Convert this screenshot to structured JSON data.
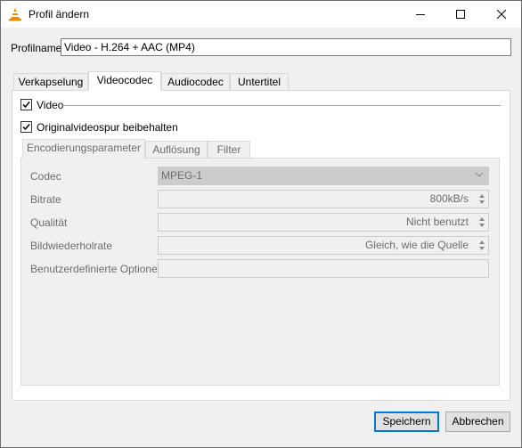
{
  "window": {
    "title": "Profil ändern",
    "icon": "vlc-cone-icon",
    "controls": [
      "minimize-icon",
      "maximize-icon",
      "close-icon"
    ]
  },
  "profile": {
    "label": "Profilname",
    "value": "Video - H.264 + AAC (MP4)"
  },
  "tabs": [
    {
      "label": "Verkapselung",
      "active": false
    },
    {
      "label": "Videocodec",
      "active": true
    },
    {
      "label": "Audiocodec",
      "active": false
    },
    {
      "label": "Untertitel",
      "active": false
    }
  ],
  "video": {
    "checkbox_label": "Video",
    "checked": true,
    "keep_original_label": "Originalvideospur beibehalten",
    "keep_original_checked": true
  },
  "inner_tabs": [
    {
      "label": "Encodierungsparameter",
      "active": true
    },
    {
      "label": "Auflösung",
      "active": false
    },
    {
      "label": "Filter",
      "active": false
    }
  ],
  "params": {
    "codec": {
      "label": "Codec",
      "value": "MPEG-1"
    },
    "bitrate": {
      "label": "Bitrate",
      "value": "800kB/s"
    },
    "quality": {
      "label": "Qualität",
      "value": "Nicht benutzt"
    },
    "framerate": {
      "label": "Bildwiederholrate",
      "value": "Gleich, wie die Quelle"
    },
    "custom": {
      "label": "Benutzerdefinierte Optionen",
      "value": ""
    }
  },
  "buttons": {
    "save": "Speichern",
    "cancel": "Abbrechen"
  },
  "colors": {
    "accent": "#0078d7",
    "vlc_orange": "#f08a00"
  }
}
